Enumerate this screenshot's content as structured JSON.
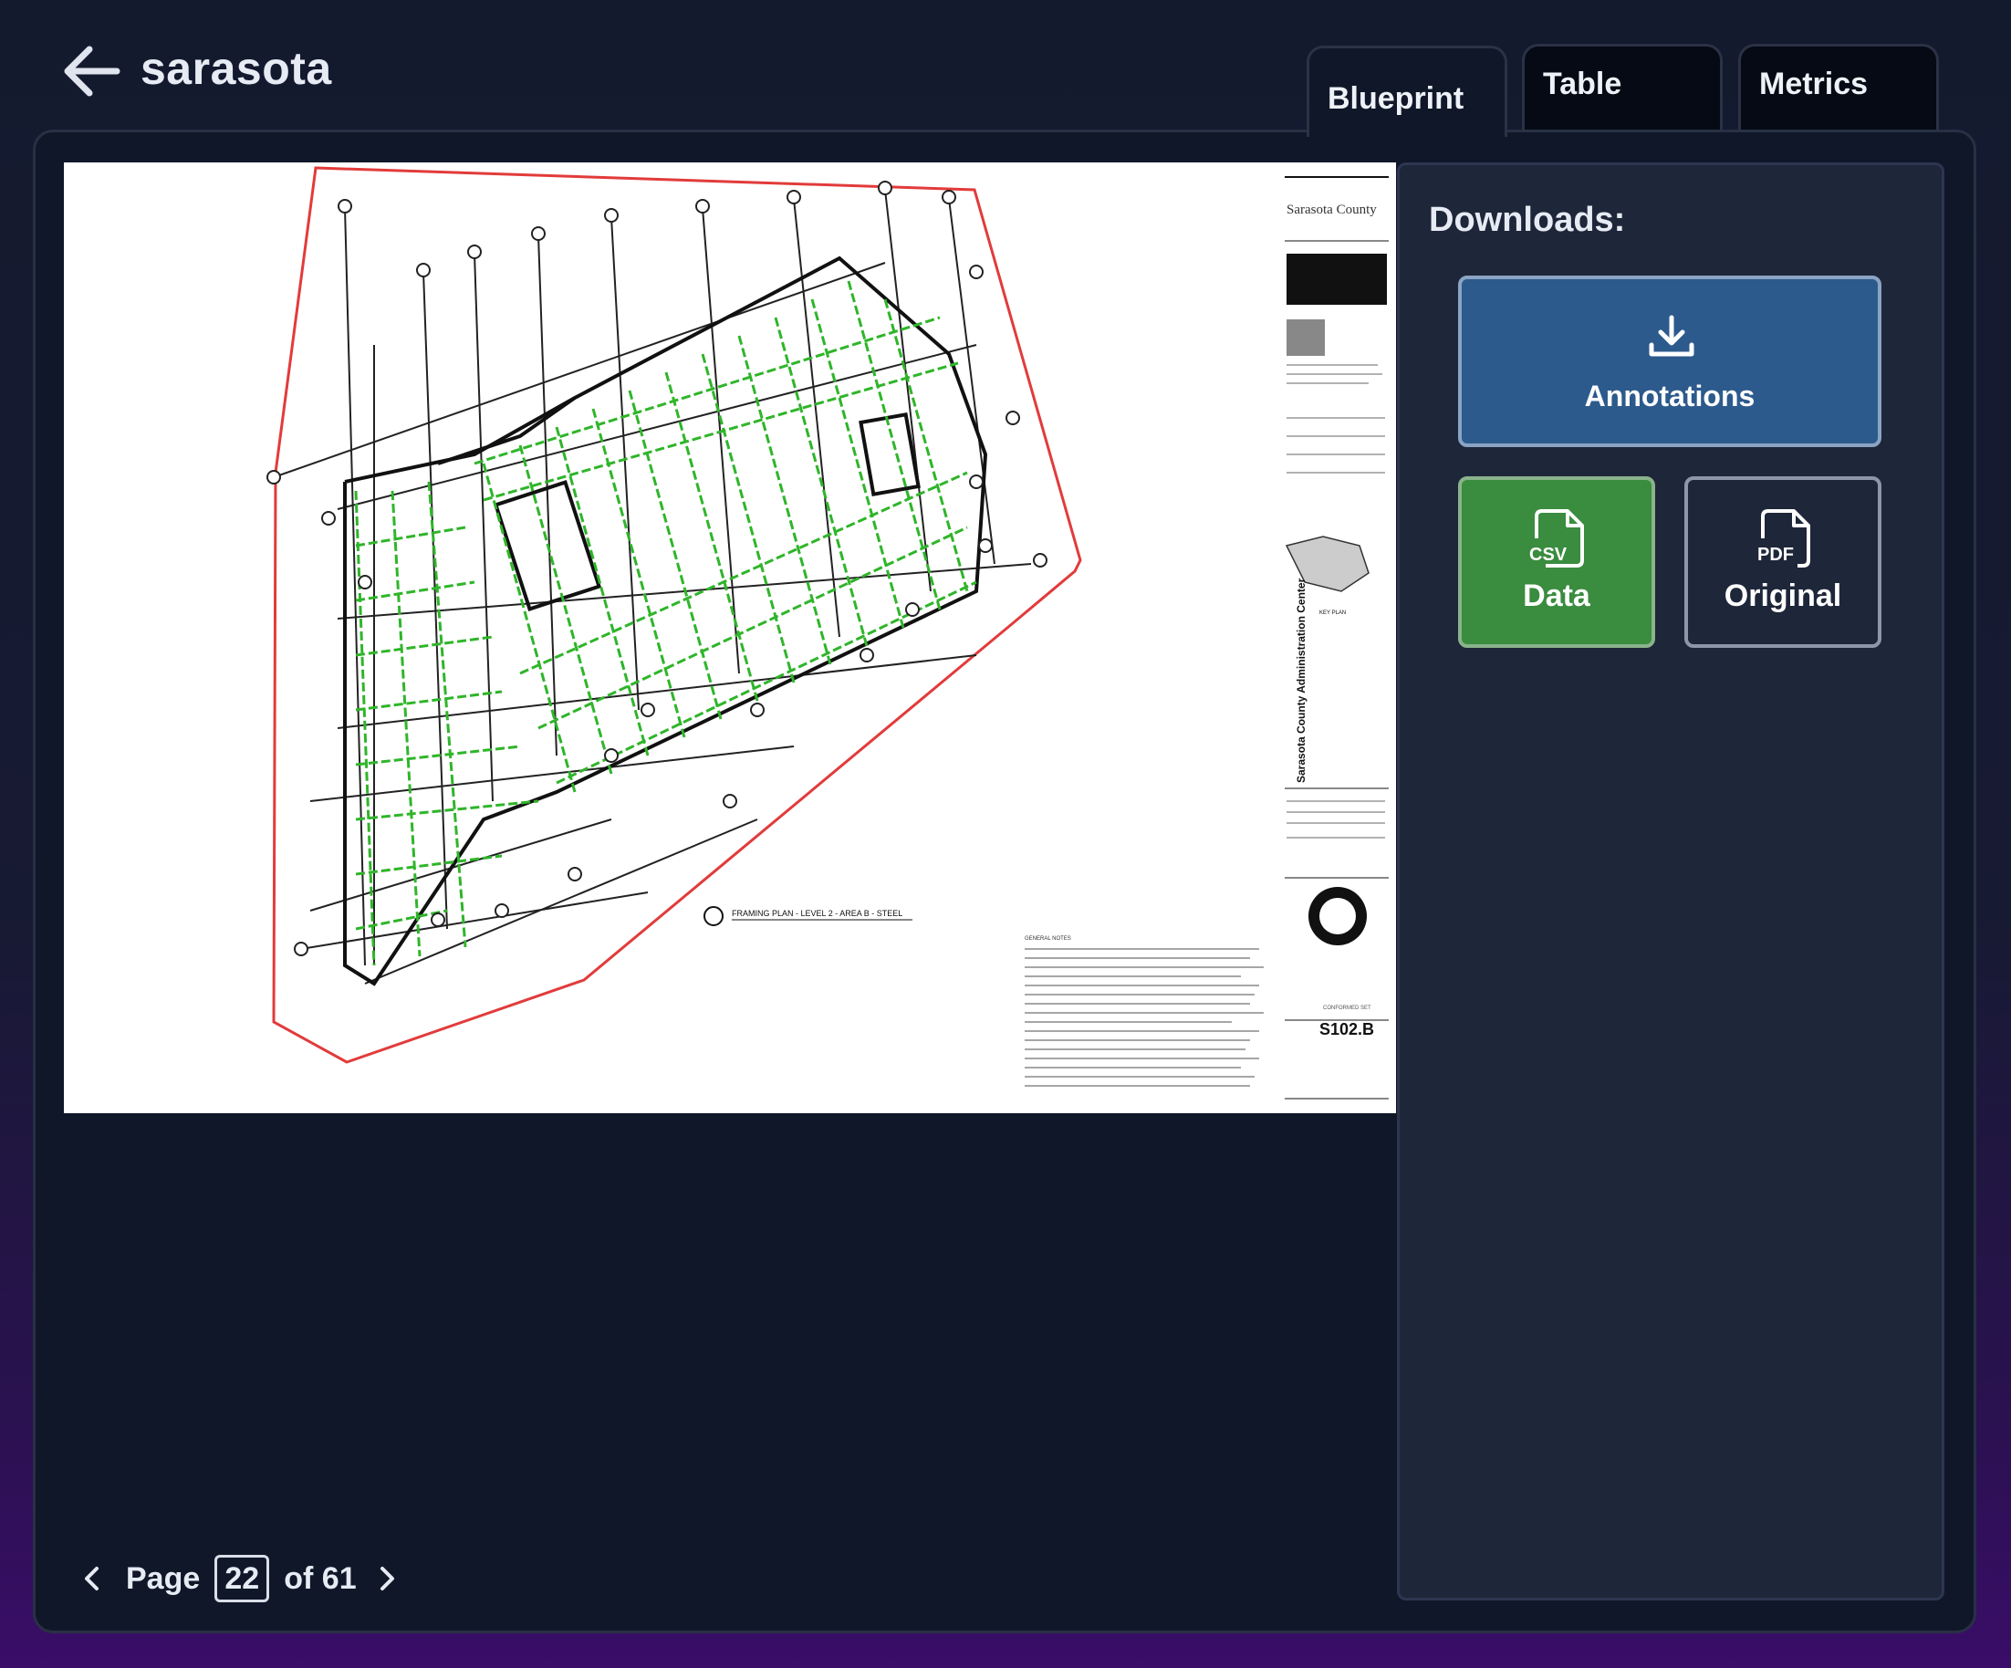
{
  "header": {
    "title": "sarasota"
  },
  "tabs": [
    {
      "label": "Blueprint",
      "active": true
    },
    {
      "label": "Table",
      "active": false
    },
    {
      "label": "Metrics",
      "active": false
    }
  ],
  "downloads": {
    "heading": "Downloads:",
    "annotations_label": "Annotations",
    "data_label": "Data",
    "data_file_type": "CSV",
    "original_label": "Original",
    "original_file_type": "PDF"
  },
  "pagination": {
    "page_label": "Page",
    "current_page": "22",
    "total_label": "of 61"
  },
  "blueprint": {
    "sheet_number": "S102.B",
    "sheet_title": "FRAMING PLAN - LEVEL 2 - AREA B",
    "plan_caption": "FRAMING PLAN - LEVEL 2 - AREA B - STEEL",
    "client_name": "Sarasota County",
    "project_name": "Sarasota County Administration Center",
    "key_plan_label": "KEY PLAN",
    "conformed_set": "CONFORMED SET",
    "notes_heading": "GENERAL NOTES"
  },
  "colors": {
    "accent_blue": "#2d5a8c",
    "accent_green": "#3a8c3f",
    "outline_red": "#e23b3b",
    "beam_green": "#2fb52a"
  }
}
